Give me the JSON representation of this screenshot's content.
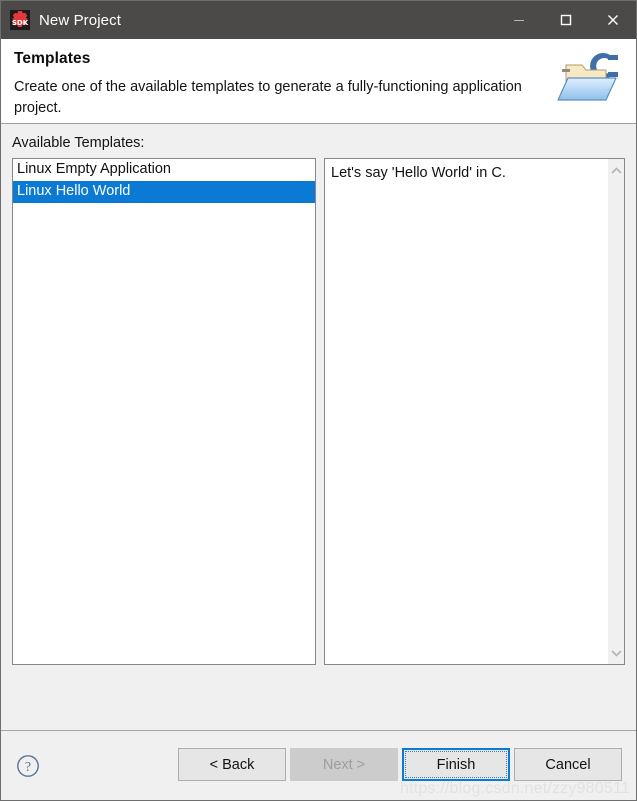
{
  "window": {
    "title": "New Project",
    "icon": "sdk-icon",
    "icon_text": "SDK",
    "controls": {
      "minimize": "minimize-icon",
      "maximize": "maximize-icon",
      "close": "close-icon"
    },
    "titlebar_color": "#4c4a48"
  },
  "header": {
    "title": "Templates",
    "description": "Create one of the available templates to generate a fully-functioning application project.",
    "icon": "c-folder-icon"
  },
  "main": {
    "list_label": "Available Templates:",
    "templates": [
      {
        "label": "Linux Empty Application",
        "selected": false
      },
      {
        "label": "Linux Hello World",
        "selected": true
      }
    ],
    "selection_color": "#0a7ad4",
    "description_panel": {
      "text": "Let's say 'Hello World' in C.",
      "scroll_up": "chevron-up-icon",
      "scroll_down": "chevron-down-icon"
    }
  },
  "footer": {
    "help": "help-icon",
    "buttons": [
      {
        "label": "< Back",
        "state": "enabled"
      },
      {
        "label": "Next >",
        "state": "disabled"
      },
      {
        "label": "Finish",
        "state": "default"
      },
      {
        "label": "Cancel",
        "state": "enabled"
      }
    ]
  },
  "watermark": "https://blog.csdn.net/zzy980511"
}
